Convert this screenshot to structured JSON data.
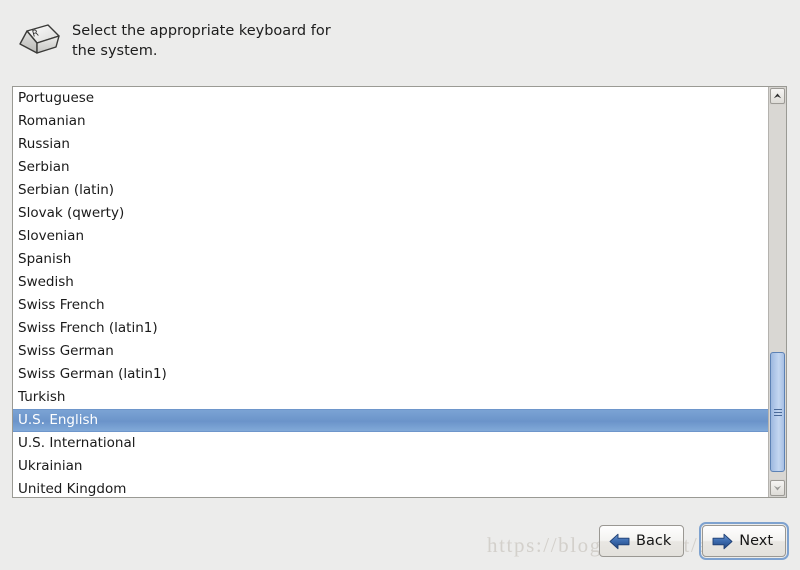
{
  "header": {
    "instruction": "Select the appropriate keyboard for\nthe system.",
    "icon": "keyboard-keycap-icon",
    "keycap_glyph": "R"
  },
  "keyboard_list": {
    "selected": "U.S. English",
    "items": [
      "Portuguese",
      "Romanian",
      "Russian",
      "Serbian",
      "Serbian (latin)",
      "Slovak (qwerty)",
      "Slovenian",
      "Spanish",
      "Swedish",
      "Swiss French",
      "Swiss French (latin1)",
      "Swiss German",
      "Swiss German (latin1)",
      "Turkish",
      "U.S. English",
      "U.S. International",
      "Ukrainian",
      "United Kingdom"
    ]
  },
  "scrollbar": {
    "up_arrow_icon": "chevron-up-icon",
    "down_arrow_icon": "chevron-down-icon",
    "thumb_grip_icon": "grip-lines-icon"
  },
  "buttons": {
    "back": {
      "label": "Back",
      "icon": "arrow-left-icon"
    },
    "next": {
      "label": "Next",
      "icon": "arrow-right-icon",
      "focused": true
    }
  },
  "watermark": {
    "text": "https://blog.csdn.net/akangwu"
  },
  "colors": {
    "window_background": "#ececeb",
    "list_background": "#ffffff",
    "selection_blue": "#6d96cb",
    "selection_text": "#ffffff",
    "arrow_blue": "#2f5fa8",
    "focus_ring": "#7ea2cf",
    "scrollbar_thumb": "#b4caea",
    "watermark_gray": "#d3d0cb"
  }
}
